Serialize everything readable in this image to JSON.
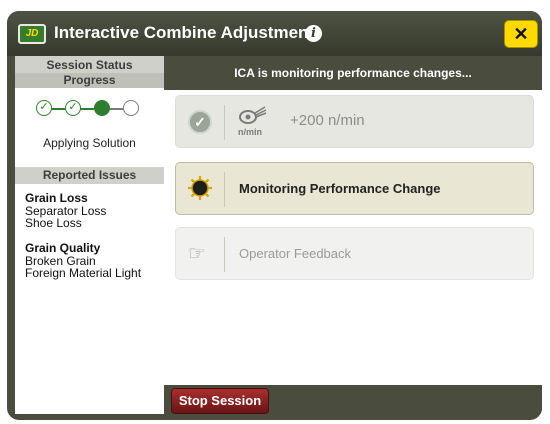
{
  "window": {
    "title": "Interactive Combine Adjustment",
    "logo_text": "JD",
    "close_label": "✕"
  },
  "sidebar": {
    "status_title": "Session Status",
    "progress_title": "Progress",
    "progress_steps_completed": 3,
    "progress_steps_total": 4,
    "phase_label": "Applying Solution",
    "issues_title": "Reported Issues",
    "issue_groups": [
      {
        "heading": "Grain Loss",
        "items": [
          "Separator Loss",
          "Shoe Loss"
        ]
      },
      {
        "heading": "Grain Quality",
        "items": [
          "Broken Grain",
          "Foreign Material Light"
        ]
      }
    ]
  },
  "main": {
    "header": "ICA is monitoring performance changes...",
    "steps": [
      {
        "state": "complete",
        "icon_label": "n/min",
        "text": "+200 n/min"
      },
      {
        "state": "active",
        "text": "Monitoring Performance Change"
      },
      {
        "state": "pending",
        "text": "Operator Feedback"
      }
    ]
  },
  "footer": {
    "stop_label": "Stop Session"
  },
  "colors": {
    "frame": "#4a4d3e",
    "accent_green": "#2f7d2f",
    "close_yellow": "#ffda00",
    "stop_red": "#8b1e1e"
  },
  "icons": {
    "logo": "john-deere-logo-icon",
    "info": "info-icon",
    "close": "close-icon",
    "check": "check-circle-icon",
    "rotor": "rotor-speed-icon",
    "monitor": "monitoring-sun-icon",
    "feedback": "pointing-hand-icon"
  }
}
